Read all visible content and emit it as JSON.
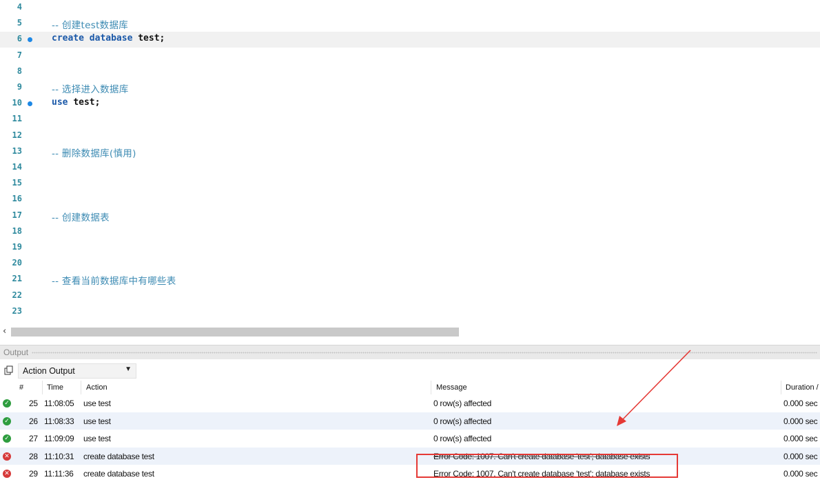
{
  "editor": {
    "lines": [
      {
        "num": "4",
        "text": ""
      },
      {
        "num": "5",
        "text": "-- 创建test数据库",
        "type": "comment"
      },
      {
        "num": "6",
        "kw": "create database",
        "id": "test;",
        "type": "code",
        "marker": true,
        "current": true
      },
      {
        "num": "7",
        "text": ""
      },
      {
        "num": "8",
        "text": ""
      },
      {
        "num": "9",
        "text": "-- 选择进入数据库",
        "type": "comment"
      },
      {
        "num": "10",
        "kw": "use",
        "id": "test;",
        "type": "code",
        "marker": true
      },
      {
        "num": "11",
        "text": ""
      },
      {
        "num": "12",
        "text": ""
      },
      {
        "num": "13",
        "text": "-- 删除数据库(慎用)",
        "type": "comment"
      },
      {
        "num": "14",
        "text": ""
      },
      {
        "num": "15",
        "text": ""
      },
      {
        "num": "16",
        "text": ""
      },
      {
        "num": "17",
        "text": "-- 创建数据表",
        "type": "comment"
      },
      {
        "num": "18",
        "text": ""
      },
      {
        "num": "19",
        "text": ""
      },
      {
        "num": "20",
        "text": ""
      },
      {
        "num": "21",
        "text": "-- 查看当前数据库中有哪些表",
        "type": "comment"
      },
      {
        "num": "22",
        "text": ""
      },
      {
        "num": "23",
        "text": ""
      }
    ]
  },
  "scrollbar": {
    "left_arrow": "‹"
  },
  "output": {
    "title": "Output",
    "dropdown_value": "Action Output",
    "columns": {
      "num": "#",
      "time": "Time",
      "action": "Action",
      "message": "Message",
      "duration": "Duration /"
    },
    "rows": [
      {
        "status": "ok",
        "num": "25",
        "time": "11:08:05",
        "action": "use test",
        "message": "0 row(s) affected",
        "duration": "0.000 sec"
      },
      {
        "status": "ok",
        "num": "26",
        "time": "11:08:33",
        "action": "use test",
        "message": "0 row(s) affected",
        "duration": "0.000 sec"
      },
      {
        "status": "ok",
        "num": "27",
        "time": "11:09:09",
        "action": "use test",
        "message": "0 row(s) affected",
        "duration": "0.000 sec"
      },
      {
        "status": "err",
        "num": "28",
        "time": "11:10:31",
        "action": "create database test",
        "message": "Error Code: 1007. Can't create database 'test'; database exists",
        "duration": "0.000 sec"
      },
      {
        "status": "err",
        "num": "29",
        "time": "11:11:36",
        "action": "create database test",
        "message": "Error Code: 1007. Can't create database 'test'; database exists",
        "duration": "0.000 sec"
      }
    ]
  },
  "colors": {
    "annotation": "#e53935",
    "ok": "#2e9d3f",
    "error": "#d63a3a",
    "keyword": "#1a58a8",
    "comment": "#3d8bb3"
  },
  "icons": {
    "ok": "check-circle-icon",
    "err": "x-circle-icon",
    "toolbar": "copy-icon",
    "dropdown": "chevron-down-icon"
  }
}
